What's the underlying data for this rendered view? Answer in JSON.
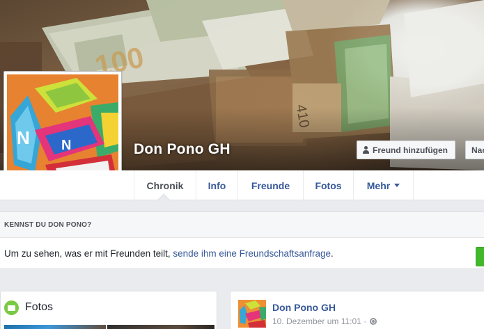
{
  "profile": {
    "name": "Don Pono GH"
  },
  "cover_actions": {
    "add_friend_label": "Freund hinzufügen",
    "message_label": "Nachricht"
  },
  "tabs": [
    {
      "label": "Chronik",
      "active": true
    },
    {
      "label": "Info"
    },
    {
      "label": "Freunde"
    },
    {
      "label": "Fotos"
    },
    {
      "label": "Mehr",
      "icon": "chevron-down-icon"
    }
  ],
  "kennst_du": {
    "heading": "KENNST DU DON PONO?",
    "text_before": "Um zu sehen, was er mit Freunden teilt,",
    "link_text": "sende ihm eine Freundschaftsanfrage",
    "text_after": "."
  },
  "fotos_card": {
    "title": "Fotos",
    "icon": "photos-icon"
  },
  "post": {
    "author": "Don Pono GH",
    "timestamp": "10. Dezember um 11:01 ·",
    "audience_icon": "globe-icon"
  },
  "colors": {
    "link_blue": "#365899",
    "background": "#e9ebee",
    "green_button": "#42b72a"
  }
}
